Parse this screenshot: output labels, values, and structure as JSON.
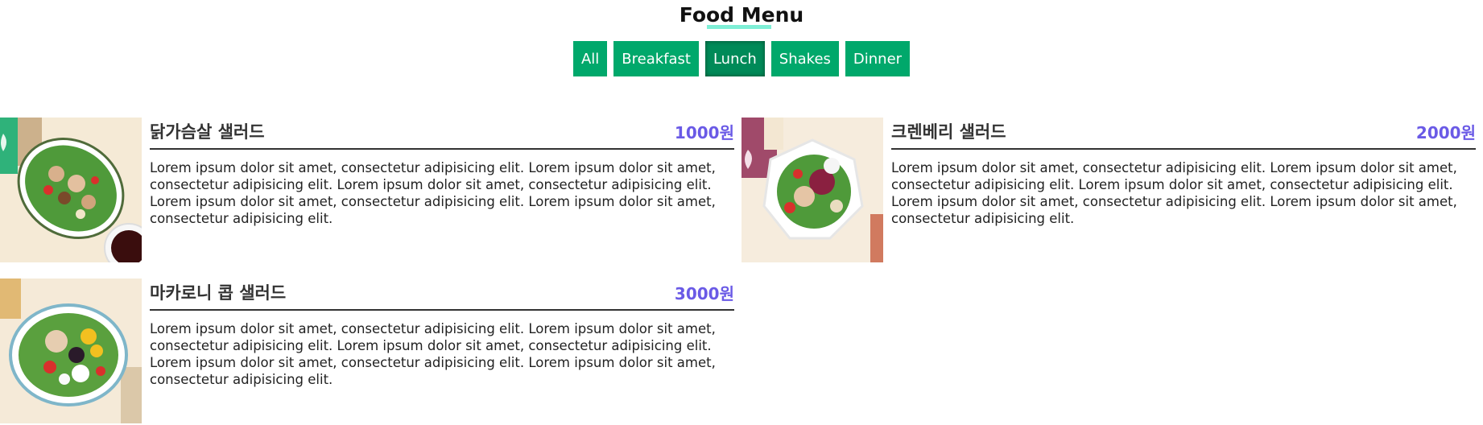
{
  "page": {
    "title": "Food Menu"
  },
  "filters": [
    {
      "label": "All",
      "active": false
    },
    {
      "label": "Breakfast",
      "active": false
    },
    {
      "label": "Lunch",
      "active": true
    },
    {
      "label": "Shakes",
      "active": false
    },
    {
      "label": "Dinner",
      "active": false
    }
  ],
  "colors": {
    "button": "#00a86b",
    "button_active": "#008a58",
    "title_underline": "#7fefd6",
    "price": "#6a5ae6"
  },
  "items": [
    {
      "name": "닭가슴살 샐러드",
      "price": "1000원",
      "description": "Lorem ipsum dolor sit amet, consectetur adipisicing elit. Lorem ipsum dolor sit amet, consectetur adipisicing elit. Lorem ipsum dolor sit amet, consectetur adipisicing elit. Lorem ipsum dolor sit amet, consectetur adipisicing elit. Lorem ipsum dolor sit amet, consectetur adipisicing elit.",
      "image": "chicken-breast-salad-photo"
    },
    {
      "name": "크렌베리 샐러드",
      "price": "2000원",
      "description": "Lorem ipsum dolor sit amet, consectetur adipisicing elit. Lorem ipsum dolor sit amet, consectetur adipisicing elit. Lorem ipsum dolor sit amet, consectetur adipisicing elit. Lorem ipsum dolor sit amet, consectetur adipisicing elit. Lorem ipsum dolor sit amet, consectetur adipisicing elit.",
      "image": "cranberry-salad-photo"
    },
    {
      "name": "마카로니 콥 샐러드",
      "price": "3000원",
      "description": "Lorem ipsum dolor sit amet, consectetur adipisicing elit. Lorem ipsum dolor sit amet, consectetur adipisicing elit. Lorem ipsum dolor sit amet, consectetur adipisicing elit. Lorem ipsum dolor sit amet, consectetur adipisicing elit. Lorem ipsum dolor sit amet, consectetur adipisicing elit.",
      "image": "macaroni-cobb-salad-photo"
    }
  ]
}
